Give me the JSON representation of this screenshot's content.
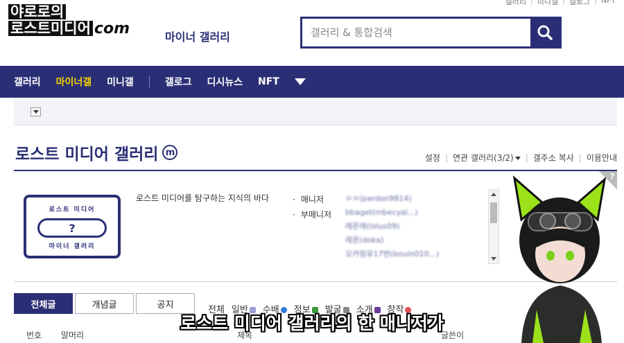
{
  "top_links": [
    "갤러리",
    "미니갤",
    "갤로그",
    "NFT"
  ],
  "channel": {
    "line1": "야로로의",
    "line2": "로스트미디어",
    "com": "com"
  },
  "logo_sub": "마이너 갤러리",
  "search": {
    "placeholder": "갤러리 & 통합검색",
    "icon": "search-icon"
  },
  "gnb": {
    "items": [
      "갤러리",
      "마이너갤",
      "미니갤",
      "갤로그",
      "디시뉴스",
      "NFT"
    ],
    "active": "마이너갤"
  },
  "gallery": {
    "title": "로스트 미디어 갤러리",
    "badge": "m",
    "links": [
      "설정",
      "연관 갤러리(3/2)",
      "갤주소 복사",
      "이용안내"
    ],
    "description": "로스트 미디어를 탐구하는 지식의 바다",
    "cassette_top": "로스트 미디어",
    "cassette_mid": "?",
    "cassette_bottom": "마이너 갤러리",
    "manager_label": "매니저",
    "submanager_label": "부매니저",
    "manager_names": [
      "ㅇㅇ(pardon9814)",
      "bbaget(mbecyal...)",
      "레몬레(lolus09)",
      "레몬(doka)",
      "오카링유17번(bouin010...)"
    ]
  },
  "tabs": [
    "전체글",
    "개념글",
    "공지"
  ],
  "heads": [
    {
      "label": "전체"
    },
    {
      "label": "일반",
      "color": "#9aa0d8"
    },
    {
      "label": "수배",
      "color": "#2b7bd8"
    },
    {
      "label": "정보",
      "color": "#3a9a3a"
    },
    {
      "label": "발굴",
      "color": "#888888"
    },
    {
      "label": "소개",
      "color": "#6a3a9a"
    },
    {
      "label": "창작",
      "color": "#e05050"
    }
  ],
  "columns": {
    "no": "번호",
    "head": "말머리",
    "title": "제목",
    "writer": "글쓴이"
  },
  "caption": "로스트 미디어 갤러리의 한 매니저가",
  "colors": {
    "primary": "#2a2f75",
    "active": "#f5d300"
  }
}
